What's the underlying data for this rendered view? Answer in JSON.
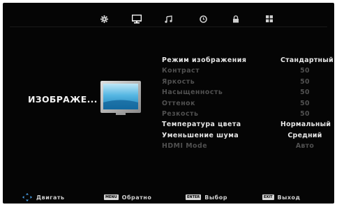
{
  "tabs": [
    {
      "icon": "gear-icon",
      "active": false
    },
    {
      "icon": "monitor-icon",
      "active": true
    },
    {
      "icon": "music-note-icon",
      "active": false
    },
    {
      "icon": "clock-icon",
      "active": false
    },
    {
      "icon": "lock-icon",
      "active": false
    },
    {
      "icon": "grid-icon",
      "active": false
    }
  ],
  "section": {
    "title": "ИЗОБРАЖЕ..."
  },
  "menu": {
    "items": [
      {
        "label": "Режим изображения",
        "value": "Стандартный",
        "enabled": true
      },
      {
        "label": "Контраст",
        "value": "50",
        "enabled": false
      },
      {
        "label": "Яркость",
        "value": "50",
        "enabled": false
      },
      {
        "label": "Насыщенность",
        "value": "50",
        "enabled": false
      },
      {
        "label": "Оттенок",
        "value": "50",
        "enabled": false
      },
      {
        "label": "Резкость",
        "value": "50",
        "enabled": false
      },
      {
        "label": "Температура цвета",
        "value": "Нормальный",
        "enabled": true
      },
      {
        "label": "Уменьшение шума",
        "value": "Средний",
        "enabled": true
      },
      {
        "label": "HDMI Mode",
        "value": "Авто",
        "enabled": false
      }
    ]
  },
  "footer": {
    "move_label": "Двигать",
    "menu_key": "MENU",
    "menu_label": "Обратно",
    "enter_key": "ENTER",
    "enter_label": "Выбор",
    "exit_key": "EXIT",
    "exit_label": "Выход"
  },
  "colors": {
    "background": "#050505",
    "text_active": "#e8e8e8",
    "text_disabled": "#505050",
    "tv_blue": "#3aa6d8"
  }
}
